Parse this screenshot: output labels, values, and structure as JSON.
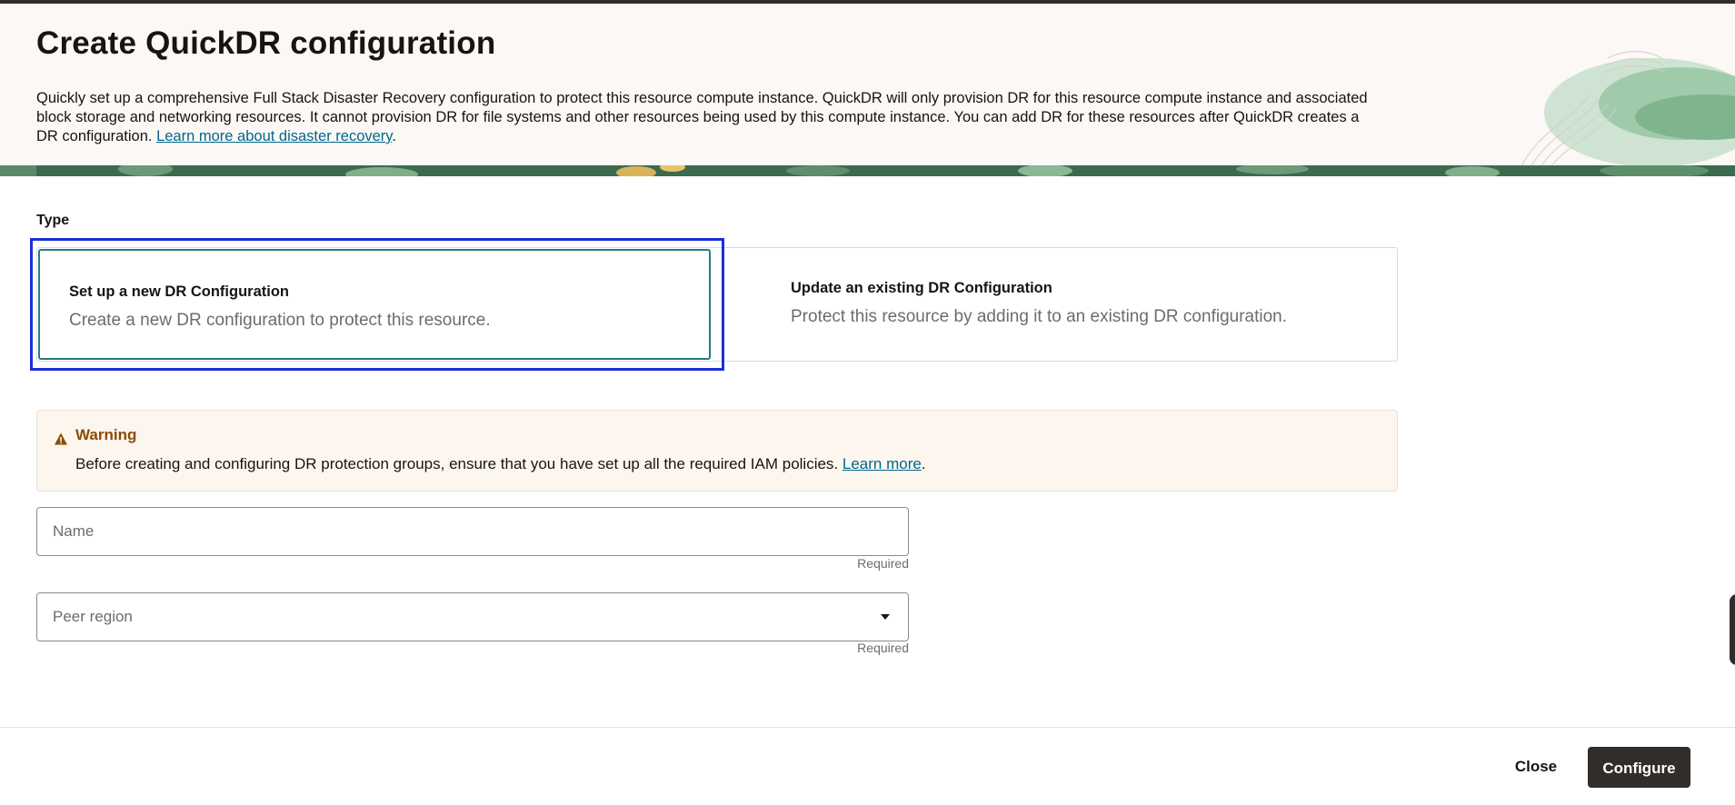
{
  "header": {
    "title": "Create QuickDR configuration",
    "description": "Quickly set up a comprehensive Full Stack Disaster Recovery configuration to protect this resource compute instance. QuickDR will only provision DR for this resource compute instance and associated block storage and networking resources. It cannot provision DR for file systems and other resources being used by this compute instance. You can add DR for these resources after QuickDR creates a DR configuration.",
    "learn_more_link": "Learn more about disaster recovery",
    "learn_more_suffix": "."
  },
  "type": {
    "label": "Type",
    "options": [
      {
        "title": "Set up a new DR Configuration",
        "description": "Create a new DR configuration to protect this resource."
      },
      {
        "title": "Update an existing DR Configuration",
        "description": "Protect this resource by adding it to an existing DR configuration."
      }
    ]
  },
  "warning": {
    "title": "Warning",
    "text": "Before creating and configuring DR protection groups, ensure that you have set up all the required IAM policies.",
    "link": "Learn more",
    "suffix": "."
  },
  "form": {
    "name": {
      "placeholder": "Name",
      "value": "",
      "hint": "Required"
    },
    "peer_region": {
      "placeholder": "Peer region",
      "hint": "Required"
    }
  },
  "footer": {
    "close_label": "Close",
    "configure_label": "Configure"
  },
  "colors": {
    "primary_button": "#312d2a",
    "selected_border": "#237b8b",
    "focus_ring": "#1a2fd6",
    "warning_text": "#8c4c00",
    "link": "#00688c"
  },
  "icons": {
    "warning": "warning-triangle-icon",
    "dropdown": "chevron-down-icon"
  }
}
